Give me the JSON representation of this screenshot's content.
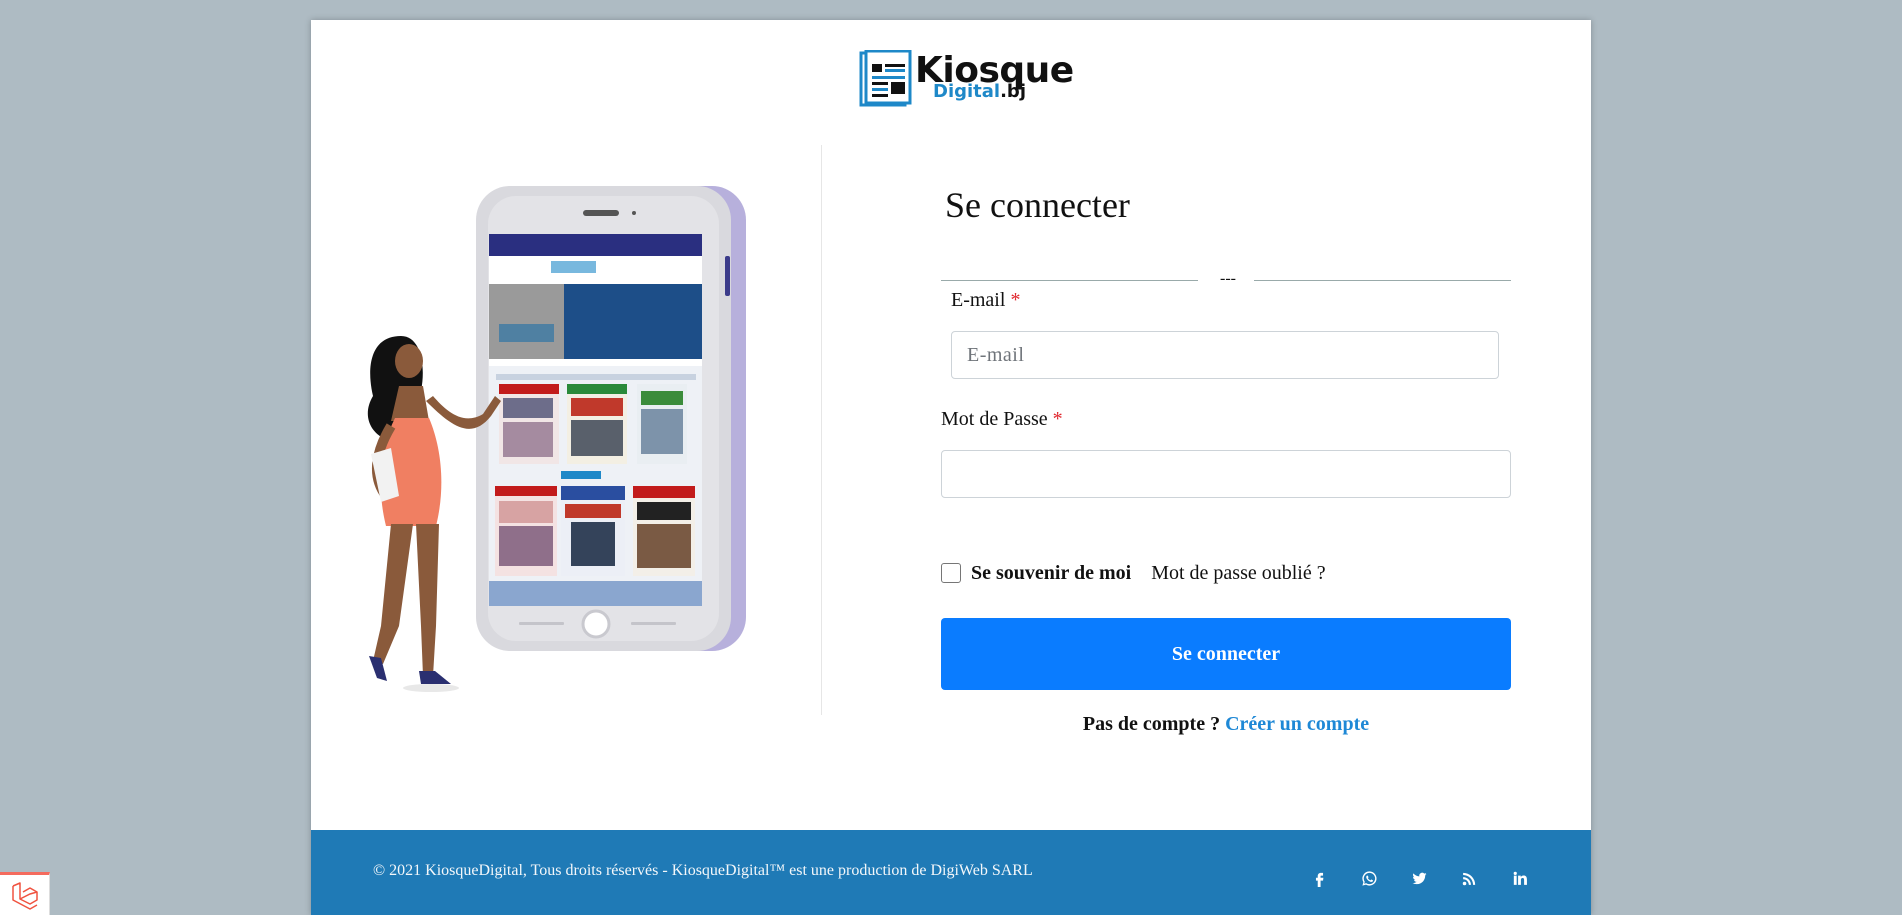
{
  "logo": {
    "main": "Kiosque",
    "sub_blue": "Digital",
    "sub_dark": ".bj"
  },
  "login": {
    "title": "Se connecter",
    "separator": "---",
    "email_label": "E-mail",
    "email_placeholder": "E-mail",
    "email_value": "",
    "password_label": "Mot de Passe",
    "password_value": "",
    "required_mark": "*",
    "remember_label": "Se souvenir de moi",
    "remember_checked": false,
    "forgot_label": "Mot de passe oublié ?",
    "submit_label": "Se connecter",
    "no_account_text": "Pas de compte ?",
    "create_account_label": "Créer un compte"
  },
  "footer": {
    "copyright": "© 2021 KiosqueDigital, Tous droits réservés - KiosqueDigital™ est une production de DigiWeb SARL",
    "socials": [
      "facebook-icon",
      "whatsapp-icon",
      "twitter-icon",
      "rss-icon",
      "linkedin-icon"
    ]
  },
  "colors": {
    "background": "#aebbc3",
    "primary_button": "#0a7cff",
    "footer": "#1f7ab6",
    "link": "#1e88d6",
    "required": "#e0262d"
  }
}
